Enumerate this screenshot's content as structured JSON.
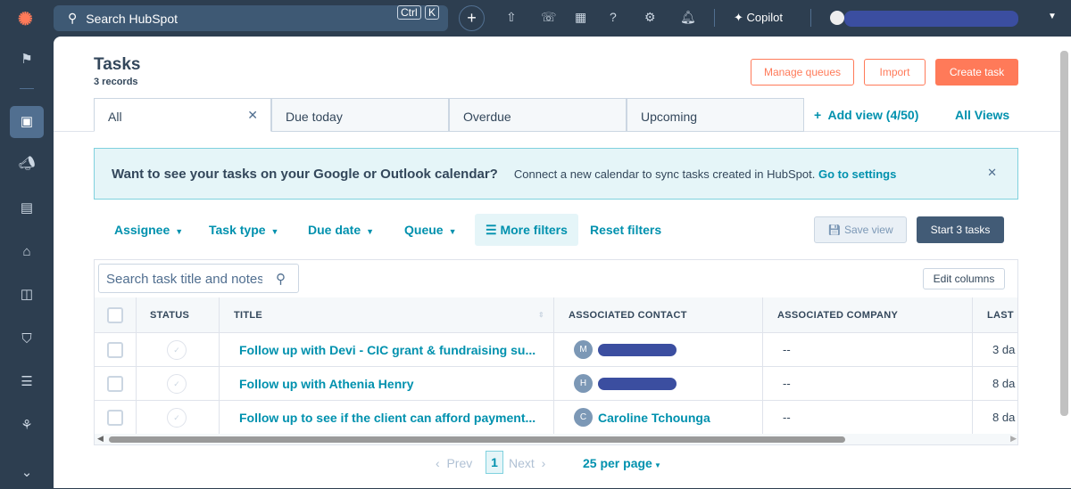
{
  "topbar": {
    "search_placeholder": "Search HubSpot",
    "kbd_ctrl": "Ctrl",
    "kbd_k": "K",
    "copilot": "Copilot"
  },
  "page": {
    "title": "Tasks",
    "records": "3 records",
    "manage_queues": "Manage queues",
    "import": "Import",
    "create_task": "Create task"
  },
  "tabs": [
    {
      "label": "All"
    },
    {
      "label": "Due today"
    },
    {
      "label": "Overdue"
    },
    {
      "label": "Upcoming"
    }
  ],
  "add_view": "Add view (4/50)",
  "all_views": "All Views",
  "banner": {
    "heading": "Want to see your tasks on your Google or Outlook calendar?",
    "text": "Connect a new calendar to sync tasks created in HubSpot.",
    "link": "Go to settings"
  },
  "filters": {
    "assignee": "Assignee",
    "task_type": "Task type",
    "due_date": "Due date",
    "queue": "Queue",
    "more": "More filters",
    "reset": "Reset filters",
    "save_view": "Save view",
    "start": "Start 3 tasks"
  },
  "table": {
    "search_placeholder": "Search task title and notes",
    "edit_columns": "Edit columns",
    "headers": [
      "STATUS",
      "TITLE",
      "ASSOCIATED CONTACT",
      "ASSOCIATED COMPANY",
      "LAST"
    ],
    "rows": [
      {
        "title": "Follow up with Devi - CIC grant & fundraising su...",
        "initial": "M",
        "contact": "",
        "company": "--",
        "last": "3 da"
      },
      {
        "title": "Follow up with Athenia Henry",
        "initial": "H",
        "contact": "",
        "company": "--",
        "last": "8 da"
      },
      {
        "title": "Follow up to see if the client can afford payment...",
        "initial": "C",
        "contact": "Caroline Tchounga",
        "company": "--",
        "last": "8 da"
      }
    ]
  },
  "pager": {
    "prev": "Prev",
    "page": "1",
    "next": "Next",
    "per_page": "25 per page"
  },
  "colors": {
    "accent": "#0091ae",
    "brand": "#ff7a59",
    "nav": "#2d3e50"
  }
}
